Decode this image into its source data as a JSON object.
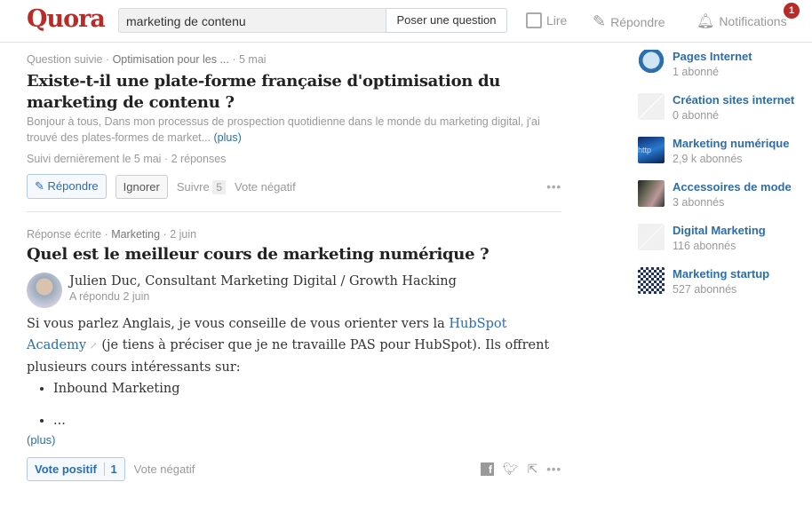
{
  "header": {
    "logo": "Quora",
    "search_value": "marketing de contenu",
    "ask_label": "Poser une question",
    "nav": [
      {
        "label": "Lire",
        "icon": "read-icon"
      },
      {
        "label": "Répondre",
        "icon": "pencil-icon"
      },
      {
        "label": "Notifications",
        "icon": "bell-icon"
      }
    ],
    "notif_count": "1"
  },
  "feed": [
    {
      "meta_type": "Question suivie",
      "meta_topic": "Optimisation pour les ...",
      "meta_date": "5 mai",
      "title": "Existe-t-il une plate-forme française d'optimisation du marketing de contenu ?",
      "snippet": "Bonjour à tous, Dans mon processus de prospection quotidienne dans le monde du marketing digital, j'ai trouvé des plates-formes de market...",
      "more": "(plus)",
      "status": "Suivi dernièrement le 5 mai · 2 réponses",
      "actions": {
        "answer": "Répondre",
        "ignore": "Ignorer",
        "follow": "Suivre",
        "follow_count": "5",
        "downvote": "Vote négatif"
      }
    },
    {
      "meta_type": "Réponse écrite",
      "meta_topic": "Marketing",
      "meta_date": "2 juin",
      "title": "Quel est le meilleur cours de marketing numérique ?",
      "author": "Julien Duc, Consultant Marketing Digital / Growth Hacking",
      "answered": "A répondu 2 juin",
      "body_before": "Si vous parlez Anglais, je vous conseille de vous orienter vers la ",
      "body_link": "HubSpot Academy",
      "body_after": " (je tiens à préciser que je ne travaille PAS pour HubSpot). Ils offrent plusieurs cours intéressants sur:",
      "bullets": [
        "Inbound Marketing",
        "..."
      ],
      "more": "(plus)",
      "actions": {
        "upvote": "Vote positif",
        "upvote_count": "1",
        "downvote": "Vote négatif"
      }
    }
  ],
  "sidebar": [
    {
      "title": "Pages Internet",
      "subs": "1 abonné"
    },
    {
      "title": "Création sites internet",
      "subs": "0 abonné"
    },
    {
      "title": "Marketing numérique",
      "subs": "2,9 k abonnés"
    },
    {
      "title": "Accessoires de mode",
      "subs": "3 abonnés"
    },
    {
      "title": "Digital Marketing",
      "subs": "116 abonnés"
    },
    {
      "title": "Marketing startup",
      "subs": "527 abonnés"
    }
  ]
}
